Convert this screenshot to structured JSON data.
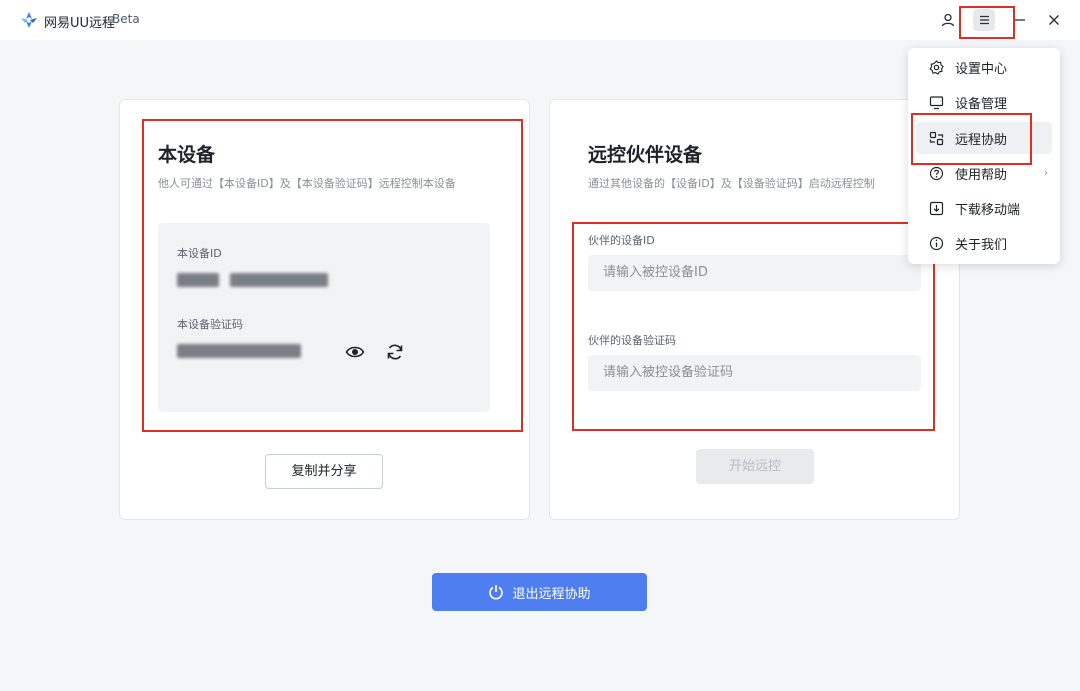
{
  "window": {
    "title": "网易UU远程",
    "badge": "Beta"
  },
  "titlebar": {
    "user_icon": "user-icon",
    "menu_icon": "menu-icon",
    "minimize_icon": "minimize-icon",
    "close_icon": "close-icon"
  },
  "local": {
    "title": "本设备",
    "subtitle": "他人可通过【本设备ID】及【本设备验证码】远程控制本设备",
    "id_label": "本设备ID",
    "code_label": "本设备验证码",
    "copy_button": "复制并分享"
  },
  "partner": {
    "title": "远控伙伴设备",
    "subtitle": "通过其他设备的【设备ID】及【设备验证码】启动远程控制",
    "id_label": "伙伴的设备ID",
    "id_placeholder": "请输入被控设备ID",
    "code_label": "伙伴的设备验证码",
    "code_placeholder": "请输入被控设备验证码",
    "start_button": "开始远控"
  },
  "exit_button": "退出远程协助",
  "menu": {
    "items": [
      {
        "label": "设置中心",
        "icon": "gear-icon"
      },
      {
        "label": "设备管理",
        "icon": "monitor-icon"
      },
      {
        "label": "远程协助",
        "icon": "remote-assist-icon"
      },
      {
        "label": "使用帮助",
        "icon": "help-icon"
      },
      {
        "label": "下载移动端",
        "icon": "download-icon"
      },
      {
        "label": "关于我们",
        "icon": "info-icon"
      }
    ]
  },
  "colors": {
    "accent": "#4e7ef0",
    "highlight": "#e02e24"
  }
}
